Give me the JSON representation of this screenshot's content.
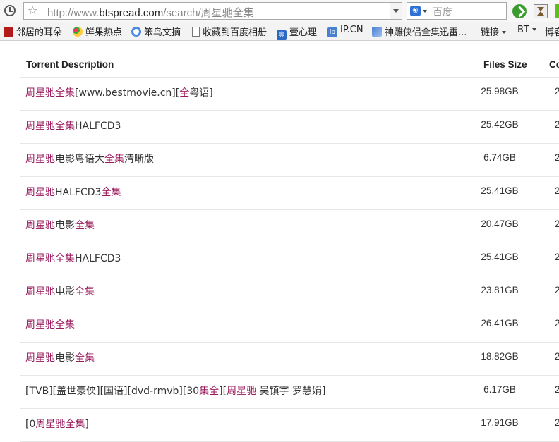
{
  "browser": {
    "url_prefix": "http://www.",
    "url_domain": "btspread.com",
    "url_path": "/search/周星驰全集",
    "search_engine_placeholder": "百度"
  },
  "bookmarks": [
    {
      "label": "邻居的耳朵",
      "icon": "ear-icon"
    },
    {
      "label": "鲜果热点",
      "icon": "fruit-icon"
    },
    {
      "label": "笨鸟文摘",
      "icon": "bird-icon"
    },
    {
      "label": "收藏到百度相册",
      "icon": "page-icon"
    },
    {
      "label": "壹心理",
      "icon": "heart-logo-icon"
    },
    {
      "label": "IP.CN",
      "icon": "ip-icon"
    },
    {
      "label": "神雕侠侣全集迅雷...",
      "icon": "hero-icon"
    },
    {
      "label": "链接",
      "icon": "chevron-down-icon"
    },
    {
      "label": "BT",
      "icon": "chevron-down-icon"
    },
    {
      "label": "博客",
      "icon": ""
    }
  ],
  "table": {
    "headers": {
      "description": "Torrent Description",
      "size": "Files Size",
      "count": "Co"
    },
    "rows": [
      {
        "parts": [
          [
            "周星驰全集",
            true
          ],
          [
            "[www.bestmovie.cn][",
            false
          ],
          [
            "全",
            true
          ],
          [
            "粤语]",
            false
          ]
        ],
        "size": "25.98GB",
        "count": "2"
      },
      {
        "parts": [
          [
            "周星驰全集",
            true
          ],
          [
            "HALFCD3",
            false
          ]
        ],
        "size": "25.42GB",
        "count": "2"
      },
      {
        "parts": [
          [
            "周星驰",
            true
          ],
          [
            "电影粤语大",
            false
          ],
          [
            "全集",
            true
          ],
          [
            "清晰版",
            false
          ]
        ],
        "size": "6.74GB",
        "count": "2"
      },
      {
        "parts": [
          [
            "周星驰",
            true
          ],
          [
            "HALFCD3",
            false
          ],
          [
            "全集",
            true
          ]
        ],
        "size": "25.41GB",
        "count": "2"
      },
      {
        "parts": [
          [
            "周星驰",
            true
          ],
          [
            "电影",
            false
          ],
          [
            "全集",
            true
          ]
        ],
        "size": "20.47GB",
        "count": "2"
      },
      {
        "parts": [
          [
            "周星驰全集",
            true
          ],
          [
            "HALFCD3",
            false
          ]
        ],
        "size": "25.41GB",
        "count": "2"
      },
      {
        "parts": [
          [
            "周星驰",
            true
          ],
          [
            "电影",
            false
          ],
          [
            "全集",
            true
          ]
        ],
        "size": "23.81GB",
        "count": "2"
      },
      {
        "parts": [
          [
            "周星驰全集",
            true
          ]
        ],
        "size": "26.41GB",
        "count": "2"
      },
      {
        "parts": [
          [
            "周星驰",
            true
          ],
          [
            "电影",
            false
          ],
          [
            "全集",
            true
          ]
        ],
        "size": "18.82GB",
        "count": "2"
      },
      {
        "parts": [
          [
            "[TVB][盖世豪侠][国语][dvd-rmvb][30",
            false
          ],
          [
            "集全",
            true
          ],
          [
            "][",
            false
          ],
          [
            "周星驰",
            true
          ],
          [
            " 吴镇宇 罗慧娟]",
            false
          ]
        ],
        "size": "6.17GB",
        "count": "2"
      },
      {
        "parts": [
          [
            "[0",
            false
          ],
          [
            "周星驰全集",
            true
          ],
          [
            "]",
            false
          ]
        ],
        "size": "17.91GB",
        "count": "2"
      }
    ]
  },
  "colors": {
    "keyword": "#9a1a5c",
    "text": "#333333"
  }
}
